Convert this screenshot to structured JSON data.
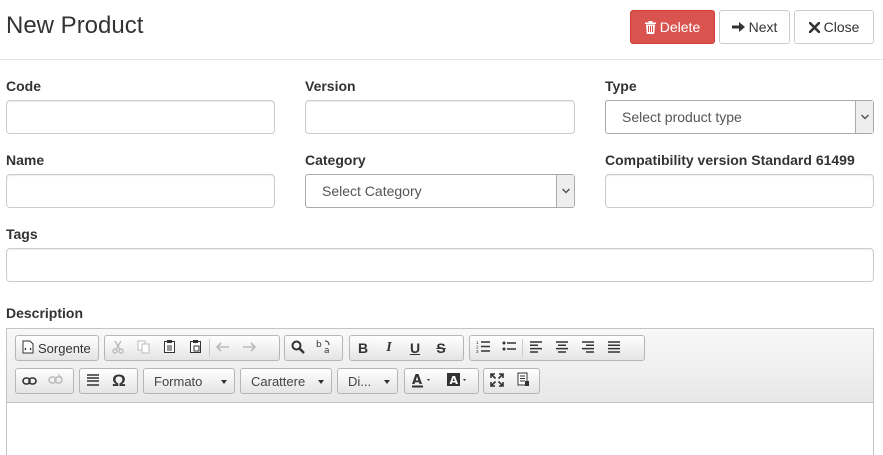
{
  "header": {
    "title": "New Product",
    "delete_label": "Delete",
    "next_label": "Next",
    "close_label": "Close"
  },
  "colors": {
    "danger": "#d9534f",
    "border": "#cccccc"
  },
  "form": {
    "code_label": "Code",
    "version_label": "Version",
    "type_label": "Type",
    "type_selected": "Select product type",
    "name_label": "Name",
    "category_label": "Category",
    "category_selected": "Select Category",
    "compat_label": "Compatibility version Standard 61499",
    "tags_label": "Tags",
    "description_label": "Description"
  },
  "editor": {
    "source_label": "Sorgente",
    "format_label": "Formato",
    "font_label": "Carattere",
    "size_label": "Di...",
    "icons": [
      "source-icon",
      "cut-icon",
      "copy-icon",
      "paste-icon",
      "paste-text-icon",
      "undo-icon",
      "redo-icon",
      "find-icon",
      "replace-icon",
      "bold-icon",
      "italic-icon",
      "underline-icon",
      "strike-icon",
      "numbered-list-icon",
      "bullet-list-icon",
      "align-left-icon",
      "align-center-icon",
      "align-right-icon",
      "justify-icon",
      "link-icon",
      "unlink-icon",
      "horizontal-rule-icon",
      "special-char-icon",
      "text-color-icon",
      "bg-color-icon",
      "maximize-icon",
      "show-blocks-icon"
    ]
  },
  "glyphs": {
    "bold": "B",
    "italic": "I",
    "underline": "U",
    "strike": "S",
    "omega": "Ω"
  }
}
